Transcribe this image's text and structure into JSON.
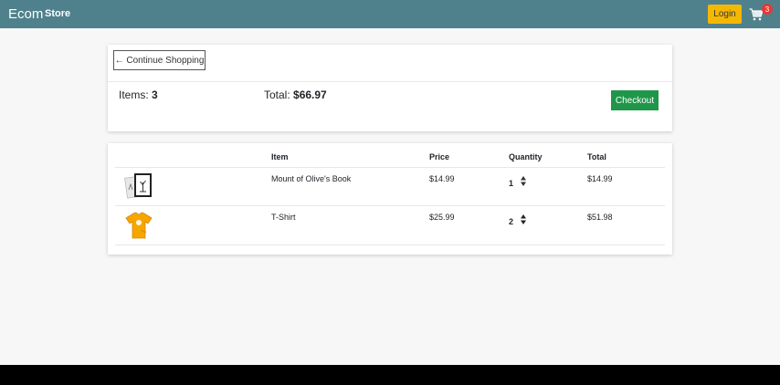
{
  "navbar": {
    "brand": "Ecom",
    "links": [
      {
        "label": "Store"
      }
    ],
    "login_label": "Login",
    "cart_count": "3",
    "bg_color": "#4f818d",
    "login_color": "#f5b800"
  },
  "summary": {
    "continue_label": "← Continue Shopping",
    "items_label": "Items: ",
    "items_value": "3",
    "total_label": "Total: ",
    "total_value": "$66.97",
    "checkout_label": "Checkout",
    "checkout_color": "#1f9649"
  },
  "cart_table": {
    "headers": [
      "",
      "Item",
      "Price",
      "Quantity",
      "Total"
    ],
    "rows": [
      {
        "image_icon": "book-icon",
        "name": "Mount of Olive's Book",
        "price": "$14.99",
        "quantity": "1",
        "total": "$14.99"
      },
      {
        "image_icon": "tshirt-icon",
        "name": "T-Shirt",
        "price": "$25.99",
        "quantity": "2",
        "total": "$51.98"
      }
    ]
  }
}
